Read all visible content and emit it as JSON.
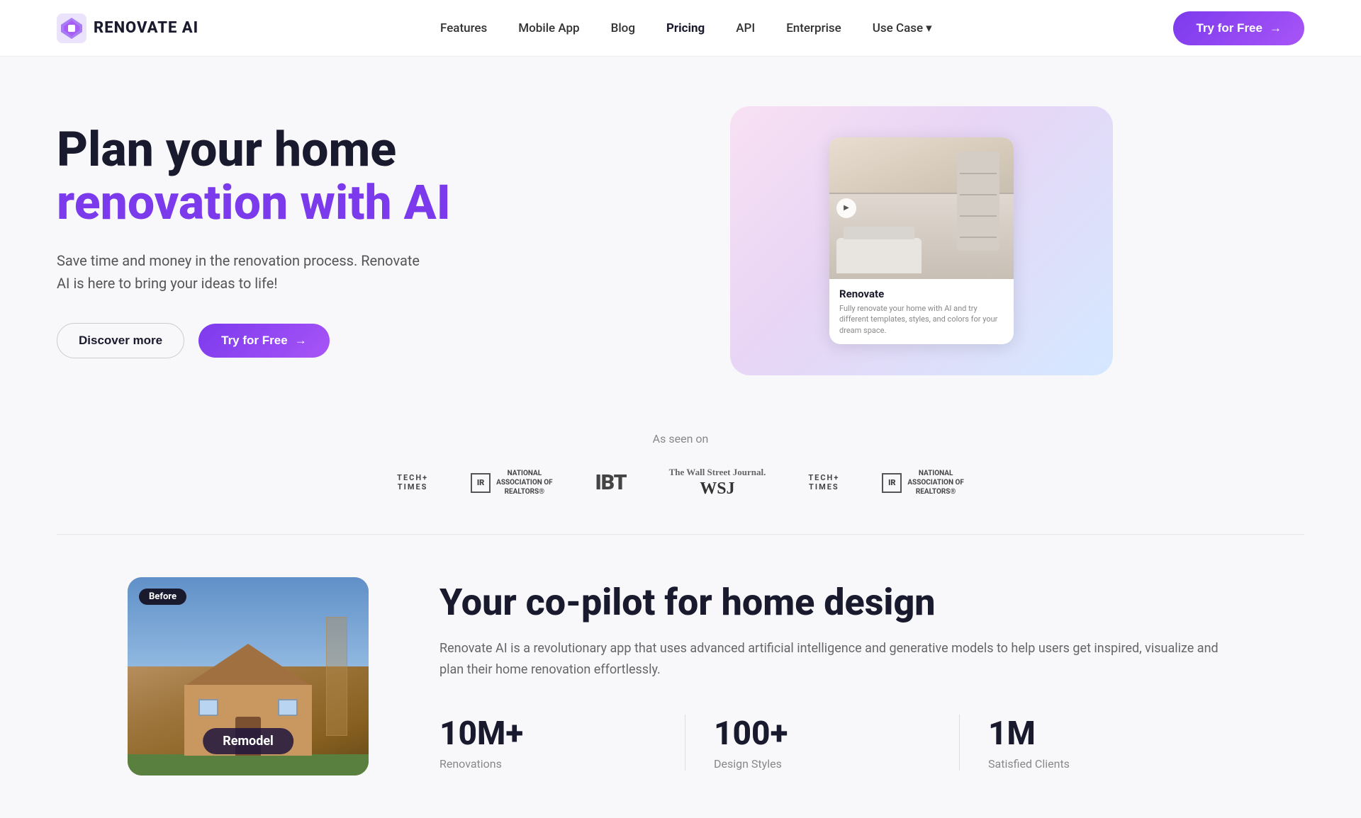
{
  "brand": {
    "name": "RENOVATE AI",
    "logo_alt": "renovate-ai-logo"
  },
  "nav": {
    "links": [
      {
        "label": "Features",
        "id": "features",
        "active": false
      },
      {
        "label": "Mobile App",
        "id": "mobile-app",
        "active": false
      },
      {
        "label": "Blog",
        "id": "blog",
        "active": false
      },
      {
        "label": "Pricing",
        "id": "pricing",
        "active": true
      },
      {
        "label": "API",
        "id": "api",
        "active": false
      },
      {
        "label": "Enterprise",
        "id": "enterprise",
        "active": false
      },
      {
        "label": "Use Case",
        "id": "use-case",
        "active": false,
        "has_chevron": true
      }
    ],
    "cta_label": "Try for Free",
    "cta_arrow": "→"
  },
  "hero": {
    "title_line1": "Plan your home",
    "title_line2": "renovation with AI",
    "description": "Save time and money in the renovation process. Renovate AI is here to bring your ideas to life!",
    "btn_discover": "Discover more",
    "btn_try": "Try for Free",
    "btn_try_arrow": "→",
    "card": {
      "room_title": "Renovate",
      "room_desc": "Fully renovate your home with AI and try different templates, styles, and colors for your dream space."
    }
  },
  "as_seen_on": {
    "label": "As seen on",
    "logos": [
      {
        "type": "tech-times",
        "text": "TECH+\nTIMES"
      },
      {
        "type": "nar",
        "text": "NATIONAL\nASSOCIATION OF\nREALTORS®"
      },
      {
        "type": "ibt",
        "text": "IBT"
      },
      {
        "type": "wsj",
        "text": "WSJ"
      },
      {
        "type": "tech-times-2",
        "text": "TECH+\nTIMES"
      },
      {
        "type": "nar-2",
        "text": "NATIONAL\nASSOCIATION OF\nREALTORS®"
      }
    ]
  },
  "section2": {
    "before_tag": "Before",
    "remodel_label": "Remodel",
    "title": "Your co-pilot for home design",
    "description": "Renovate AI is a revolutionary app that uses advanced artificial intelligence and generative models to help users get inspired, visualize and plan their home renovation effortlessly.",
    "stats": [
      {
        "number": "10M+",
        "label": "Renovations"
      },
      {
        "number": "100+",
        "label": "Design Styles"
      },
      {
        "number": "1M",
        "label": "Satisfied Clients"
      }
    ]
  }
}
